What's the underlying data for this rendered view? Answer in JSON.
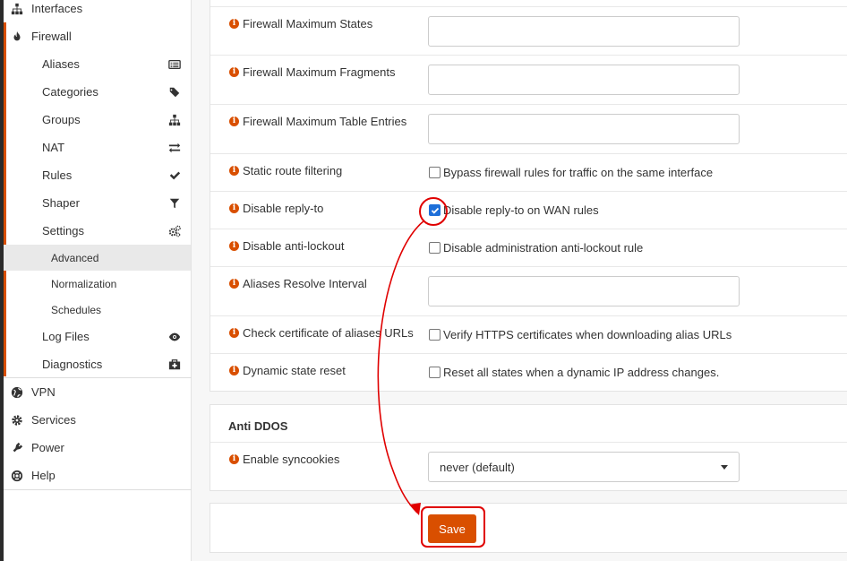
{
  "sidebar": {
    "items": [
      {
        "label": "Interfaces",
        "icon": "sitemap-icon"
      },
      {
        "label": "Firewall",
        "icon": "fire-icon"
      },
      {
        "label": "Aliases",
        "icon": "list-icon"
      },
      {
        "label": "Categories",
        "icon": "tags-icon"
      },
      {
        "label": "Groups",
        "icon": "sitemap-icon"
      },
      {
        "label": "NAT",
        "icon": "exchange-icon"
      },
      {
        "label": "Rules",
        "icon": "check-icon"
      },
      {
        "label": "Shaper",
        "icon": "filter-icon"
      },
      {
        "label": "Settings",
        "icon": "cogs-icon"
      },
      {
        "label": "Advanced"
      },
      {
        "label": "Normalization"
      },
      {
        "label": "Schedules"
      },
      {
        "label": "Log Files",
        "icon": "eye-icon"
      },
      {
        "label": "Diagnostics",
        "icon": "medkit-icon"
      },
      {
        "label": "VPN",
        "icon": "globe-icon"
      },
      {
        "label": "Services",
        "icon": "cog-icon"
      },
      {
        "label": "Power",
        "icon": "plug-icon"
      },
      {
        "label": "Help",
        "icon": "life-ring-icon"
      }
    ]
  },
  "settings": {
    "max_states": {
      "label": "Firewall Maximum States",
      "value": ""
    },
    "max_fragments": {
      "label": "Firewall Maximum Fragments",
      "value": ""
    },
    "max_table_entries": {
      "label": "Firewall Maximum Table Entries",
      "value": ""
    },
    "static_route_filtering": {
      "label": "Static route filtering",
      "checkbox_label": "Bypass firewall rules for traffic on the same interface",
      "checked": false
    },
    "disable_reply_to": {
      "label": "Disable reply-to",
      "checkbox_label": "Disable reply-to on WAN rules",
      "checked": true
    },
    "disable_anti_lockout": {
      "label": "Disable anti-lockout",
      "checkbox_label": "Disable administration anti-lockout rule",
      "checked": false
    },
    "aliases_resolve_interval": {
      "label": "Aliases Resolve Interval",
      "value": ""
    },
    "check_cert_aliases": {
      "label": "Check certificate of aliases URLs",
      "checkbox_label": "Verify HTTPS certificates when downloading alias URLs",
      "checked": false
    },
    "dynamic_state_reset": {
      "label": "Dynamic state reset",
      "checkbox_label": "Reset all states when a dynamic IP address changes.",
      "checked": false
    }
  },
  "anti_ddos": {
    "title": "Anti DDOS",
    "enable_syncookies": {
      "label": "Enable syncookies",
      "selected": "never (default)"
    }
  },
  "actions": {
    "save_label": "Save"
  },
  "colors": {
    "accent": "#d94f00",
    "annotation": "#e00000",
    "checkbox_checked": "#1e6fd9"
  }
}
